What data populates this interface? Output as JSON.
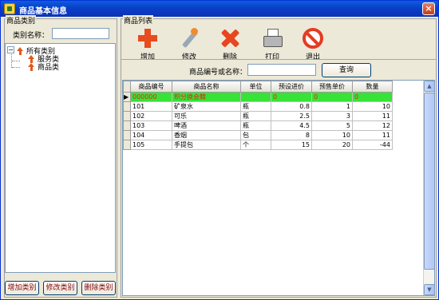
{
  "window": {
    "title": "商品基本信息",
    "close_label": "×"
  },
  "left": {
    "group_label": "商品类别",
    "category_name_label": "类别名称：",
    "category_name_value": "",
    "tree": {
      "root": {
        "label": "所有类别",
        "expander": "−"
      },
      "children": [
        {
          "label": "服务类"
        },
        {
          "label": "商品类"
        }
      ]
    },
    "buttons": {
      "add": "增加类别",
      "edit": "修改类别",
      "delete": "删除类别"
    }
  },
  "right": {
    "group_label": "商品列表",
    "toolbar": {
      "add": "增加",
      "edit": "修改",
      "delete": "删除",
      "print": "打印",
      "exit": "退出"
    },
    "search": {
      "label": "商品编号或名称：",
      "value": "",
      "query_button": "查询"
    },
    "table": {
      "headers": [
        "商品编号",
        "商品名称",
        "单位",
        "预设进价",
        "预售单价",
        "数量"
      ],
      "rows": [
        {
          "indicator": "▶",
          "cells": [
            "000000",
            "积分换会籍",
            "",
            "0",
            "0",
            "0"
          ],
          "selected": true
        },
        {
          "indicator": "",
          "cells": [
            "101",
            "矿泉水",
            "瓶",
            "0.8",
            "1",
            "10"
          ],
          "selected": false
        },
        {
          "indicator": "",
          "cells": [
            "102",
            "可乐",
            "瓶",
            "2.5",
            "3",
            "11"
          ],
          "selected": false
        },
        {
          "indicator": "",
          "cells": [
            "103",
            "啤酒",
            "瓶",
            "4.5",
            "5",
            "12"
          ],
          "selected": false
        },
        {
          "indicator": "",
          "cells": [
            "104",
            "香烟",
            "包",
            "8",
            "10",
            "11"
          ],
          "selected": false
        },
        {
          "indicator": "",
          "cells": [
            "105",
            "手提包",
            "个",
            "15",
            "20",
            "-44"
          ],
          "selected": false
        }
      ]
    }
  },
  "colors": {
    "titlebar": "#0a3fc6",
    "selected_row": "#36e336",
    "selected_text": "#e0281a",
    "button_text": "#800000"
  }
}
